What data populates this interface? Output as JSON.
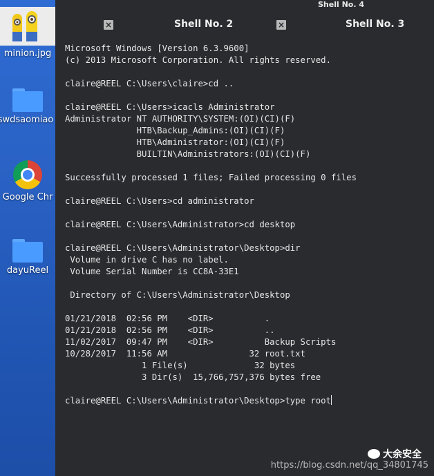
{
  "desktop": {
    "items": [
      {
        "label": "minion.jpg",
        "icon": "image-thumbnail-icon"
      },
      {
        "label": "swdsaomiao",
        "icon": "folder-icon"
      },
      {
        "label": "Google Chr",
        "icon": "chrome-icon"
      },
      {
        "label": "dayuReel",
        "icon": "folder-icon"
      }
    ]
  },
  "window": {
    "title": "Shell No. 4"
  },
  "tabs": [
    {
      "label": "Shell No. 2",
      "close": "×"
    },
    {
      "label": "Shell No. 3",
      "close": "×"
    }
  ],
  "terminal": {
    "lines": [
      "Microsoft Windows [Version 6.3.9600]",
      "(c) 2013 Microsoft Corporation. All rights reserved.",
      "",
      "claire@REEL C:\\Users\\claire>cd ..",
      "",
      "claire@REEL C:\\Users>icacls Administrator",
      "Administrator NT AUTHORITY\\SYSTEM:(OI)(CI)(F)",
      "              HTB\\Backup_Admins:(OI)(CI)(F)",
      "              HTB\\Administrator:(OI)(CI)(F)",
      "              BUILTIN\\Administrators:(OI)(CI)(F)",
      "",
      "Successfully processed 1 files; Failed processing 0 files",
      "",
      "claire@REEL C:\\Users>cd administrator",
      "",
      "claire@REEL C:\\Users\\Administrator>cd desktop",
      "",
      "claire@REEL C:\\Users\\Administrator\\Desktop>dir",
      " Volume in drive C has no label.",
      " Volume Serial Number is CC8A-33E1",
      "",
      " Directory of C:\\Users\\Administrator\\Desktop",
      "",
      "01/21/2018  02:56 PM    <DIR>          .",
      "01/21/2018  02:56 PM    <DIR>          ..",
      "11/02/2017  09:47 PM    <DIR>          Backup Scripts",
      "10/28/2017  11:56 AM                32 root.txt",
      "               1 File(s)             32 bytes",
      "               3 Dir(s)  15,766,757,376 bytes free",
      "",
      "claire@REEL C:\\Users\\Administrator\\Desktop>type root"
    ]
  },
  "watermark": {
    "brand": "大余安全",
    "url": "https://blog.csdn.net/qq_34801745"
  }
}
